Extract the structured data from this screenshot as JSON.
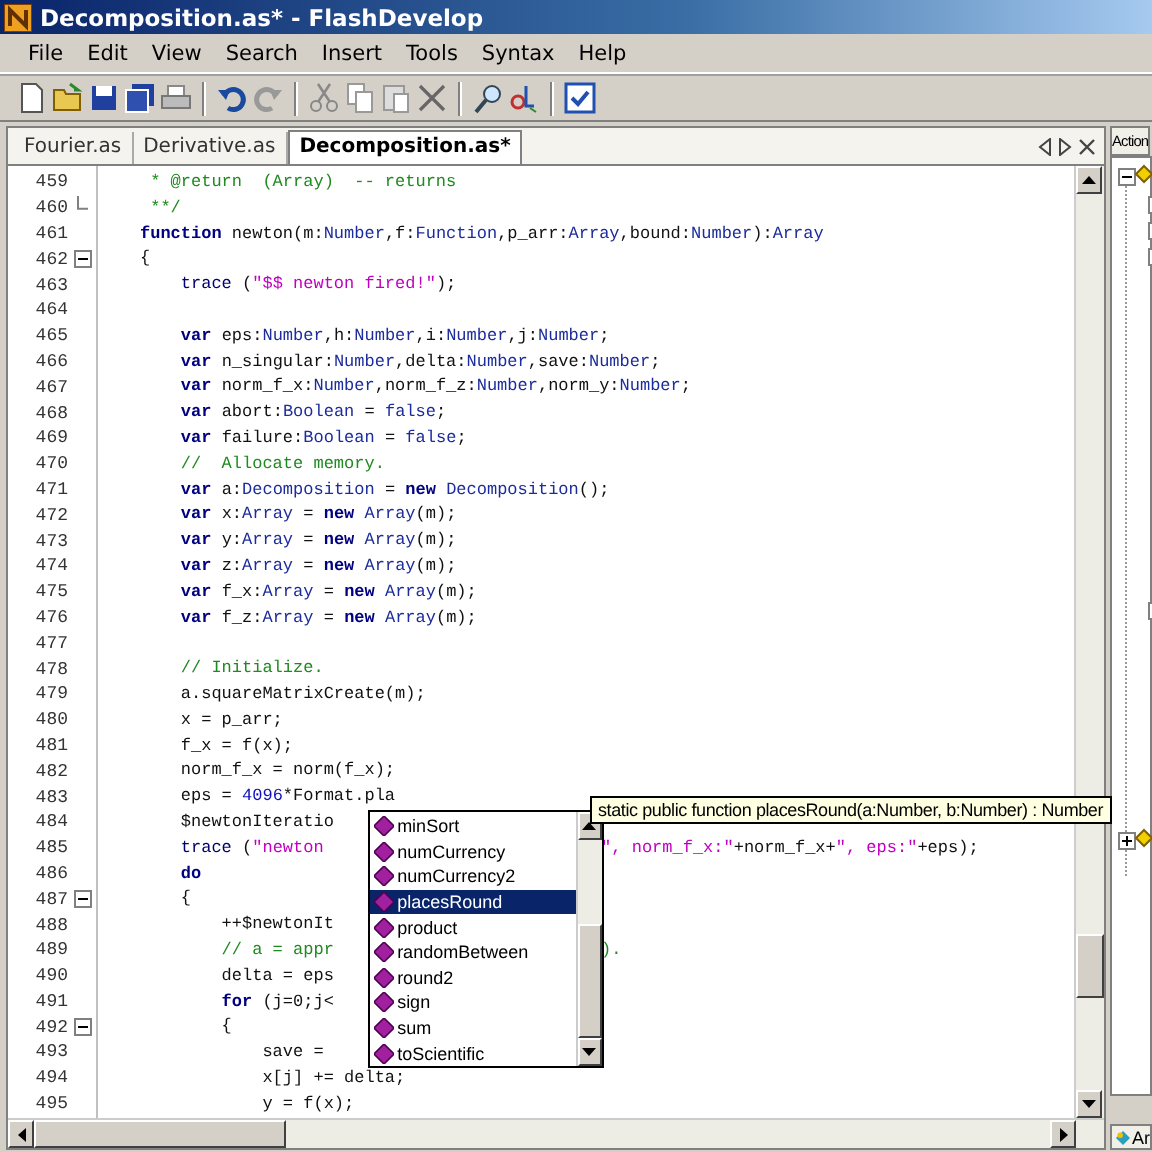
{
  "window": {
    "title": "Decomposition.as* - FlashDevelop"
  },
  "menu": [
    "File",
    "Edit",
    "View",
    "Search",
    "Insert",
    "Tools",
    "Syntax",
    "Help"
  ],
  "tabs": [
    {
      "label": "Fourier.as",
      "selected": false
    },
    {
      "label": "Derivative.as",
      "selected": false
    },
    {
      "label": "Decomposition.as*",
      "selected": true
    }
  ],
  "editor": {
    "lines": [
      {
        "number": "459",
        "code": [
          {
            "kind": "com",
            "text": " * @return  (Array)  -- returns"
          }
        ]
      },
      {
        "number": "460",
        "kind": "fold_end",
        "code": [
          {
            "kind": "com",
            "text": " **/"
          }
        ]
      },
      {
        "number": "461",
        "code": [
          {
            "kind": "kw",
            "text": "function"
          },
          {
            "kind": "p",
            "text": " newton(m:"
          },
          {
            "kind": "ty",
            "text": "Number"
          },
          {
            "kind": "p",
            "text": ",f:"
          },
          {
            "kind": "ty",
            "text": "Function"
          },
          {
            "kind": "p",
            "text": ",p_arr:"
          },
          {
            "kind": "ty",
            "text": "Array"
          },
          {
            "kind": "p",
            "text": ",bound:"
          },
          {
            "kind": "ty",
            "text": "Number"
          },
          {
            "kind": "p",
            "text": "):"
          },
          {
            "kind": "ty",
            "text": "Array"
          }
        ]
      },
      {
        "number": "462",
        "kind": "fold_start",
        "code": [
          {
            "kind": "p",
            "text": "{"
          }
        ]
      },
      {
        "number": "463",
        "code": [
          {
            "kind": "bi",
            "text": "    trace"
          },
          {
            "kind": "p",
            "text": " ("
          },
          {
            "kind": "str",
            "text": "\"$$ newton fired!\""
          },
          {
            "kind": "p",
            "text": ");"
          }
        ]
      },
      {
        "number": "464"
      },
      {
        "number": "465",
        "code": [
          {
            "kind": "kw",
            "text": "    var"
          },
          {
            "kind": "p",
            "text": " eps:"
          },
          {
            "kind": "ty",
            "text": "Number"
          },
          {
            "kind": "p",
            "text": ",h:"
          },
          {
            "kind": "ty",
            "text": "Number"
          },
          {
            "kind": "p",
            "text": ",i:"
          },
          {
            "kind": "ty",
            "text": "Number"
          },
          {
            "kind": "p",
            "text": ",j:"
          },
          {
            "kind": "ty",
            "text": "Number"
          },
          {
            "kind": "p",
            "text": ";"
          }
        ]
      },
      {
        "number": "466",
        "code": [
          {
            "kind": "kw",
            "text": "    var"
          },
          {
            "kind": "p",
            "text": " n_singular:"
          },
          {
            "kind": "ty",
            "text": "Number"
          },
          {
            "kind": "p",
            "text": ",delta:"
          },
          {
            "kind": "ty",
            "text": "Number"
          },
          {
            "kind": "p",
            "text": ",save:"
          },
          {
            "kind": "ty",
            "text": "Number"
          },
          {
            "kind": "p",
            "text": ";"
          }
        ]
      },
      {
        "number": "467",
        "code": [
          {
            "kind": "kw",
            "text": "    var"
          },
          {
            "kind": "p",
            "text": " norm_f_x:"
          },
          {
            "kind": "ty",
            "text": "Number"
          },
          {
            "kind": "p",
            "text": ",norm_f_z:"
          },
          {
            "kind": "ty",
            "text": "Number"
          },
          {
            "kind": "p",
            "text": ",norm_y:"
          },
          {
            "kind": "ty",
            "text": "Number"
          },
          {
            "kind": "p",
            "text": ";"
          }
        ]
      },
      {
        "number": "468",
        "code": [
          {
            "kind": "kw",
            "text": "    var"
          },
          {
            "kind": "p",
            "text": " abort:"
          },
          {
            "kind": "ty",
            "text": "Boolean"
          },
          {
            "kind": "p",
            "text": " = "
          },
          {
            "kind": "ty",
            "text": "false"
          },
          {
            "kind": "p",
            "text": ";"
          }
        ]
      },
      {
        "number": "469",
        "code": [
          {
            "kind": "kw",
            "text": "    var"
          },
          {
            "kind": "p",
            "text": " failure:"
          },
          {
            "kind": "ty",
            "text": "Boolean"
          },
          {
            "kind": "p",
            "text": " = "
          },
          {
            "kind": "ty",
            "text": "false"
          },
          {
            "kind": "p",
            "text": ";"
          }
        ]
      },
      {
        "number": "470",
        "code": [
          {
            "kind": "com",
            "text": "    //  Allocate memory."
          }
        ]
      },
      {
        "number": "471",
        "code": [
          {
            "kind": "kw",
            "text": "    var"
          },
          {
            "kind": "p",
            "text": " a:"
          },
          {
            "kind": "ty",
            "text": "Decomposition"
          },
          {
            "kind": "p",
            "text": " = "
          },
          {
            "kind": "kw",
            "text": "new"
          },
          {
            "kind": "ty",
            "text": " Decomposition"
          },
          {
            "kind": "p",
            "text": "();"
          }
        ]
      },
      {
        "number": "472",
        "code": [
          {
            "kind": "kw",
            "text": "    var"
          },
          {
            "kind": "p",
            "text": " x:"
          },
          {
            "kind": "ty",
            "text": "Array"
          },
          {
            "kind": "p",
            "text": " = "
          },
          {
            "kind": "kw",
            "text": "new"
          },
          {
            "kind": "ty",
            "text": " Array"
          },
          {
            "kind": "p",
            "text": "(m);"
          }
        ]
      },
      {
        "number": "473",
        "code": [
          {
            "kind": "kw",
            "text": "    var"
          },
          {
            "kind": "p",
            "text": " y:"
          },
          {
            "kind": "ty",
            "text": "Array"
          },
          {
            "kind": "p",
            "text": " = "
          },
          {
            "kind": "kw",
            "text": "new"
          },
          {
            "kind": "ty",
            "text": " Array"
          },
          {
            "kind": "p",
            "text": "(m);"
          }
        ]
      },
      {
        "number": "474",
        "code": [
          {
            "kind": "kw",
            "text": "    var"
          },
          {
            "kind": "p",
            "text": " z:"
          },
          {
            "kind": "ty",
            "text": "Array"
          },
          {
            "kind": "p",
            "text": " = "
          },
          {
            "kind": "kw",
            "text": "new"
          },
          {
            "kind": "ty",
            "text": " Array"
          },
          {
            "kind": "p",
            "text": "(m);"
          }
        ]
      },
      {
        "number": "475",
        "code": [
          {
            "kind": "kw",
            "text": "    var"
          },
          {
            "kind": "p",
            "text": " f_x:"
          },
          {
            "kind": "ty",
            "text": "Array"
          },
          {
            "kind": "p",
            "text": " = "
          },
          {
            "kind": "kw",
            "text": "new"
          },
          {
            "kind": "ty",
            "text": " Array"
          },
          {
            "kind": "p",
            "text": "(m);"
          }
        ]
      },
      {
        "number": "476",
        "code": [
          {
            "kind": "kw",
            "text": "    var"
          },
          {
            "kind": "p",
            "text": " f_z:"
          },
          {
            "kind": "ty",
            "text": "Array"
          },
          {
            "kind": "p",
            "text": " = "
          },
          {
            "kind": "kw",
            "text": "new"
          },
          {
            "kind": "ty",
            "text": " Array"
          },
          {
            "kind": "p",
            "text": "(m);"
          }
        ]
      },
      {
        "number": "477"
      },
      {
        "number": "478",
        "code": [
          {
            "kind": "com",
            "text": "    // Initialize."
          }
        ]
      },
      {
        "number": "479",
        "code": [
          {
            "kind": "p",
            "text": "    a.squareMatrixCreate(m);"
          }
        ]
      },
      {
        "number": "480",
        "code": [
          {
            "kind": "p",
            "text": "    x = p_arr;"
          }
        ]
      },
      {
        "number": "481",
        "code": [
          {
            "kind": "p",
            "text": "    f_x = f(x);"
          }
        ]
      },
      {
        "number": "482",
        "code": [
          {
            "kind": "p",
            "text": "    norm_f_x = norm(f_x);"
          }
        ]
      },
      {
        "number": "483",
        "code": [
          {
            "kind": "p",
            "text": "    eps = "
          },
          {
            "kind": "num",
            "text": "4096"
          },
          {
            "kind": "p",
            "text": "*Format.pla"
          }
        ]
      },
      {
        "number": "484",
        "code": [
          {
            "kind": "p",
            "text": "    $newtonIteratio"
          }
        ]
      },
      {
        "number": "485",
        "code": [
          {
            "kind": "bi",
            "text": "    trace"
          },
          {
            "kind": "p",
            "text": " ("
          },
          {
            "kind": "str",
            "text": "\"newton"
          }
        ],
        "tail": [
          {
            "kind": "str",
            "text": "\", norm_f_x:\""
          },
          {
            "kind": "p",
            "text": "+norm_f_x+"
          },
          {
            "kind": "str",
            "text": "\", eps:\""
          },
          {
            "kind": "p",
            "text": "+eps);"
          }
        ]
      },
      {
        "number": "486",
        "code": [
          {
            "kind": "kw",
            "text": "    do"
          }
        ]
      },
      {
        "number": "487",
        "kind": "fold_start",
        "code": [
          {
            "kind": "p",
            "text": "    {"
          }
        ]
      },
      {
        "number": "488",
        "code": [
          {
            "kind": "p",
            "text": "        ++$newtonIt"
          }
        ]
      },
      {
        "number": "489",
        "code": [
          {
            "kind": "com",
            "text": "        // a = appr"
          }
        ],
        "tail": [
          {
            "kind": "com",
            "text": ")."
          }
        ]
      },
      {
        "number": "490",
        "code": [
          {
            "kind": "p",
            "text": "        delta = eps"
          }
        ]
      },
      {
        "number": "491",
        "code": [
          {
            "kind": "kw",
            "text": "        for"
          },
          {
            "kind": "p",
            "text": " (j=0;j<"
          }
        ]
      },
      {
        "number": "492",
        "kind": "fold_start",
        "code": [
          {
            "kind": "p",
            "text": "        {"
          }
        ]
      },
      {
        "number": "493",
        "code": [
          {
            "kind": "p",
            "text": "            save ="
          }
        ]
      },
      {
        "number": "494",
        "code": [
          {
            "kind": "p",
            "text": "            x[j] += delta;"
          }
        ]
      },
      {
        "number": "495",
        "code": [
          {
            "kind": "p",
            "text": "            y = f(x);"
          }
        ]
      }
    ]
  },
  "autocomplete": {
    "items": [
      {
        "label": "minSort",
        "selected": false
      },
      {
        "label": "numCurrency",
        "selected": false
      },
      {
        "label": "numCurrency2",
        "selected": false
      },
      {
        "label": "placesRound",
        "selected": true
      },
      {
        "label": "product",
        "selected": false
      },
      {
        "label": "randomBetween",
        "selected": false
      },
      {
        "label": "round2",
        "selected": false
      },
      {
        "label": "sign",
        "selected": false
      },
      {
        "label": "sum",
        "selected": false
      },
      {
        "label": "toScientific",
        "selected": false
      }
    ]
  },
  "tooltip": "static public function placesRound(a:Number, b:Number) : Number",
  "side_panel": {
    "tab": "Action",
    "bottom_tab": "Ar"
  }
}
